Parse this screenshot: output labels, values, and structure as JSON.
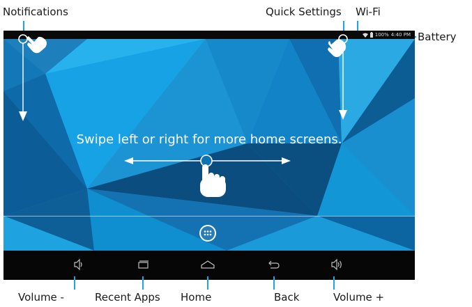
{
  "callouts": {
    "notifications": "Notifications",
    "quick_settings": "Quick Settings",
    "wifi": "Wi-Fi",
    "battery": "Battery",
    "volume_down": "Volume -",
    "recent_apps": "Recent Apps",
    "home": "Home",
    "back": "Back",
    "volume_up": "Volume +"
  },
  "status_bar": {
    "battery_percent": "100%",
    "time": "4:40 PM"
  },
  "home_screen": {
    "tip": "Swipe left or right for more home screens."
  },
  "icons": {
    "status": [
      "wifi-icon",
      "battery-icon"
    ],
    "dock": [
      "all-apps-icon"
    ],
    "nav": [
      "volume-down-icon",
      "recent-apps-icon",
      "home-icon",
      "back-icon",
      "volume-up-icon"
    ],
    "gestures": [
      "swipe-down-hand-icon",
      "swipe-horizontal-hand-icon"
    ]
  },
  "colors": {
    "callout_line": "#1aa6df",
    "wallpaper_light": "#16a7e8",
    "wallpaper_dark": "#0a4f80",
    "bars": "#060606"
  }
}
